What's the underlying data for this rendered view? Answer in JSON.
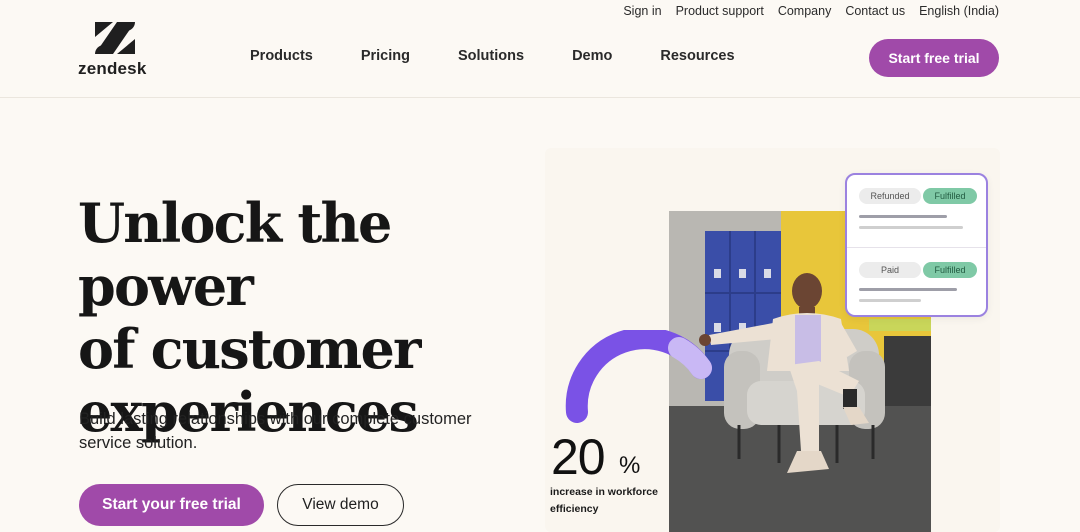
{
  "brand": {
    "name": "zendesk",
    "mark": "zendesk-logo"
  },
  "utility_nav": [
    "Sign in",
    "Product support",
    "Company",
    "Contact us",
    "English (India)"
  ],
  "main_nav": [
    "Products",
    "Pricing",
    "Solutions",
    "Demo",
    "Resources"
  ],
  "header_cta": "Start free trial",
  "hero": {
    "title_lines": [
      "Unlock the power",
      "of customer",
      "experiences"
    ],
    "subtitle": "Build lasting relationships with our complete customer service solution.",
    "primary_cta": "Start your free trial",
    "secondary_cta": "View demo"
  },
  "stat": {
    "number": "20",
    "unit": "%",
    "caption_lines": [
      "increase in workforce",
      "efficiency"
    ]
  },
  "card": {
    "rows": [
      {
        "status": "Refunded",
        "badge": "Fulfilled"
      },
      {
        "status": "Paid",
        "badge": "Fulfilled"
      }
    ]
  },
  "colors": {
    "background": "#fcf9f4",
    "accent_purple": "#a04aa9",
    "arc_purple": "#7a52e6",
    "badge_green": "#7fc9a6",
    "card_border": "#9b82e0"
  }
}
